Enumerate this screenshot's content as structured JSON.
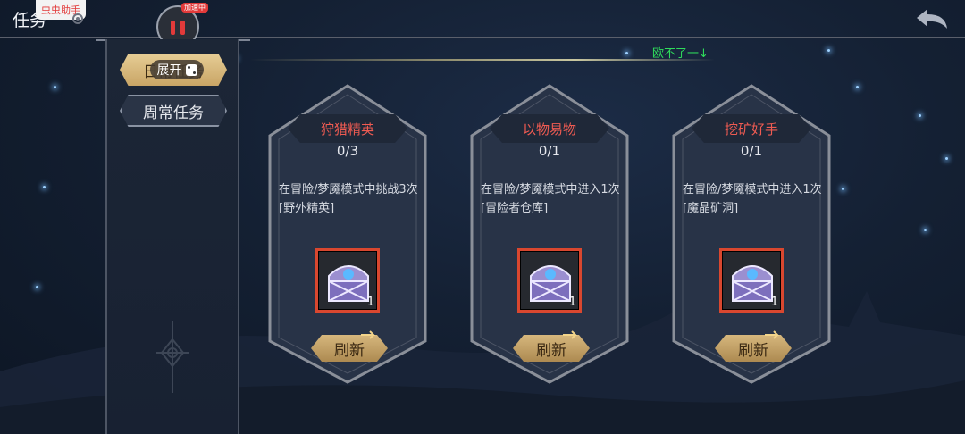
{
  "header": {
    "title": "任务",
    "helper_badge": "虫虫助手",
    "pause_tag": "加速中"
  },
  "tabs": [
    {
      "label": "日常任务",
      "active": true
    },
    {
      "label": "周常任务",
      "active": false
    }
  ],
  "expand_chip": {
    "label": "展开"
  },
  "toast": "欧不了一↓",
  "quests": [
    {
      "name": "狩猎精英",
      "progress": "0/3",
      "description": "在冒险/梦魇模式中挑战3次[野外精英]",
      "reward_qty": "1",
      "refresh_label": "刷新"
    },
    {
      "name": "以物易物",
      "progress": "0/1",
      "description": "在冒险/梦魇模式中进入1次[冒险者仓库]",
      "reward_qty": "1",
      "refresh_label": "刷新"
    },
    {
      "name": "挖矿好手",
      "progress": "0/1",
      "description": "在冒险/梦魇模式中进入1次[魔晶矿洞]",
      "reward_qty": "1",
      "refresh_label": "刷新"
    }
  ],
  "icons": {
    "settings": "gear-icon",
    "pause": "pause-icon",
    "back": "back-arrow-icon",
    "reward": "treasure-chest-icon",
    "refresh": "refresh-arrows-icon"
  },
  "colors": {
    "quest_title": "#ef5b52",
    "toast": "#2fdc5b",
    "active_tab": "#d9bb7c",
    "reward_border": "#d9472f"
  }
}
